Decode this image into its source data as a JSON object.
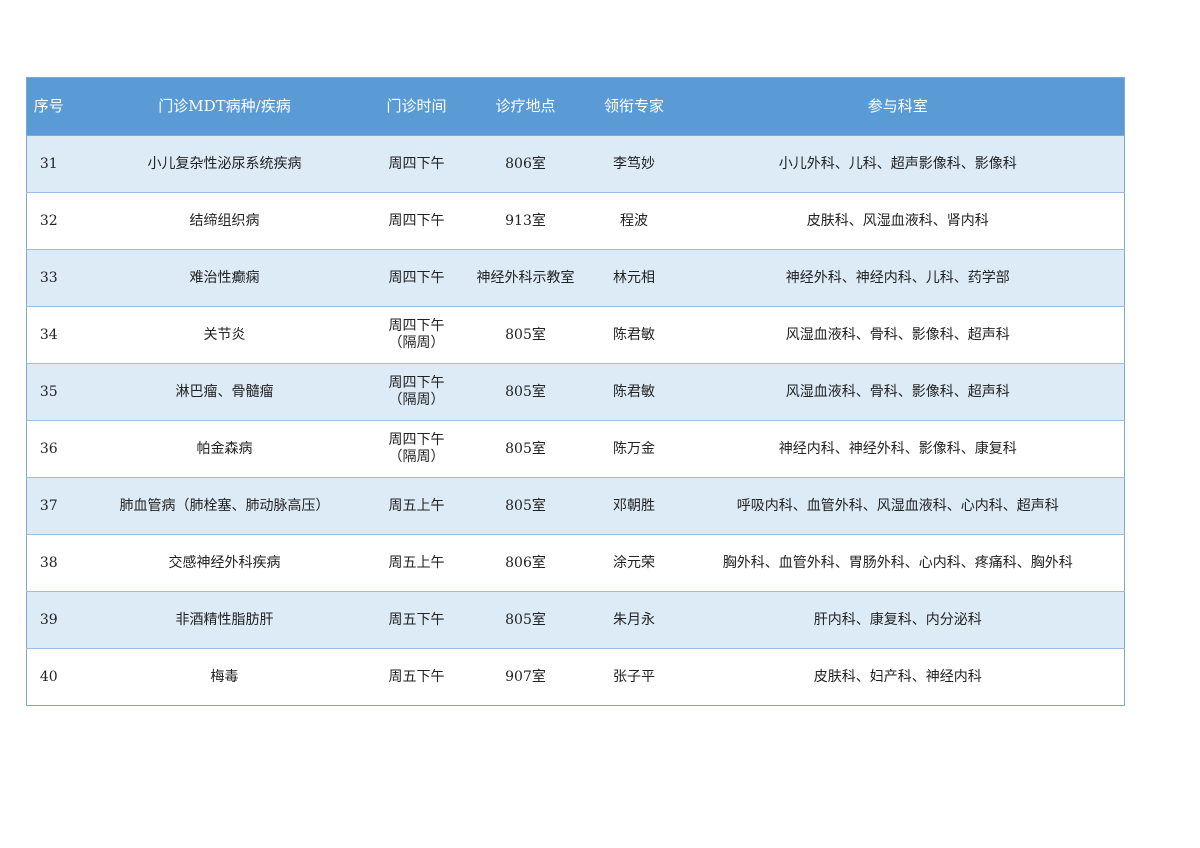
{
  "table": {
    "headers": [
      "序号",
      "门诊MDT病种/疾病",
      "门诊时间",
      "诊疗地点",
      "领衔专家",
      "参与科室"
    ],
    "rows": [
      [
        "31",
        "小儿复杂性泌尿系统疾病",
        "周四下午",
        "806室",
        "李笃妙",
        "小儿外科、儿科、超声影像科、影像科"
      ],
      [
        "32",
        "结缔组织病",
        "周四下午",
        "913室",
        "程波",
        "皮肤科、风湿血液科、肾内科"
      ],
      [
        "33",
        "难治性癫痫",
        "周四下午",
        "神经外科示教室",
        "林元相",
        "神经外科、神经内科、儿科、药学部"
      ],
      [
        "34",
        "关节炎",
        "周四下午（隔周）",
        "805室",
        "陈君敏",
        "风湿血液科、骨科、影像科、超声科"
      ],
      [
        "35",
        "淋巴瘤、骨髓瘤",
        "周四下午（隔周）",
        "805室",
        "陈君敏",
        "风湿血液科、骨科、影像科、超声科"
      ],
      [
        "36",
        "帕金森病",
        "周四下午（隔周）",
        "805室",
        "陈万金",
        "神经内科、神经外科、影像科、康复科"
      ],
      [
        "37",
        "肺血管病（肺栓塞、肺动脉高压）",
        "周五上午",
        "805室",
        "邓朝胜",
        "呼吸内科、血管外科、风湿血液科、心内科、超声科"
      ],
      [
        "38",
        "交感神经外科疾病",
        "周五上午",
        "806室",
        "涂元荣",
        "胸外科、血管外科、胃肠外科、心内科、疼痛科、胸外科"
      ],
      [
        "39",
        "非酒精性脂肪肝",
        "周五下午",
        "805室",
        "朱月永",
        "肝内科、康复科、内分泌科"
      ],
      [
        "40",
        "梅毒",
        "周五下午",
        "907室",
        "张子平",
        "皮肤科、妇产科、神经内科"
      ]
    ]
  },
  "colors": {
    "header_bg": "#5b9bd5",
    "header_text": "#ffffff",
    "row_alt_bg": "#ddebf7",
    "row_bg": "#ffffff",
    "border": "#7fa7d3"
  }
}
